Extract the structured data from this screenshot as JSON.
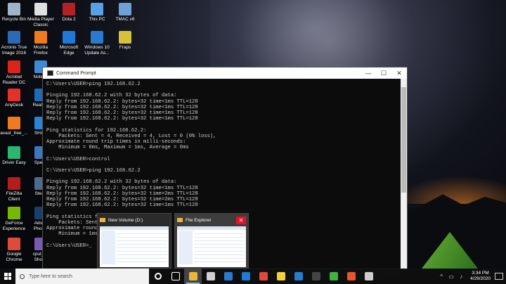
{
  "desktop_icons": [
    {
      "label": "Recycle Bin",
      "color": "#9fb4c9"
    },
    {
      "label": "Media Player\nClassic",
      "color": "#e0e0e0"
    },
    {
      "label": "Dota 2",
      "color": "#b22222"
    },
    {
      "label": "This PC",
      "color": "#5aa0e6"
    },
    {
      "label": "TMAC v6",
      "color": "#6fa0d8"
    },
    {
      "label": "Acronis True\nImage 2016",
      "color": "#2b6bb5"
    },
    {
      "label": "Mozilla\nFirefox",
      "color": "#f07b1e"
    },
    {
      "label": "Microsoft\nEdge",
      "color": "#1e7ad6"
    },
    {
      "label": "Windows 10\nUpdate As...",
      "color": "#2a7ad0"
    },
    {
      "label": "Fraps",
      "color": "#d6c23a"
    },
    {
      "label": "Acrobat\nReader DC",
      "color": "#d9251c"
    },
    {
      "label": "Notepa",
      "color": "#3f8ad6"
    },
    {
      "label": "AnyDesk",
      "color": "#e5312a"
    },
    {
      "label": "RealPla",
      "color": "#1f6ab8"
    },
    {
      "label": "avast_free_...",
      "color": "#f07b1e"
    },
    {
      "label": "SHAR",
      "color": "#2a84d6"
    },
    {
      "label": "Driver Easy",
      "color": "#2bb673"
    },
    {
      "label": "Speco",
      "color": "#3c78c0"
    },
    {
      "label": "FileZilla\nClient",
      "color": "#b51c1c"
    },
    {
      "label": "Stean",
      "color": "#4b6c8f"
    },
    {
      "label": "GeForce\nExperience",
      "color": "#77b900"
    },
    {
      "label": "Adobe\nPhotos",
      "color": "#1a3f6c"
    },
    {
      "label": "Google\nChrome",
      "color": "#e04a3a"
    },
    {
      "label": "cput_x6\nShortc",
      "color": "#7a5ab5"
    }
  ],
  "cmd": {
    "title": "Command Prompt",
    "minimize": "—",
    "maximize": "☐",
    "close": "✕",
    "lines": [
      "C:\\Users\\USER>ping 192.168.62.2",
      "",
      "Pinging 192.168.62.2 with 32 bytes of data:",
      "Reply from 192.168.62.2: bytes=32 time<1ms TTL=128",
      "Reply from 192.168.62.2: bytes=32 time<1ms TTL=128",
      "Reply from 192.168.62.2: bytes=32 time=1ms TTL=128",
      "Reply from 192.168.62.2: bytes=32 time<1ms TTL=128",
      "",
      "Ping statistics for 192.168.62.2:",
      "    Packets: Sent = 4, Received = 4, Lost = 0 (0% loss),",
      "Approximate round trip times in milli-seconds:",
      "    Minimum = 0ms, Maximum = 1ms, Average = 0ms",
      "",
      "C:\\Users\\USER>control",
      "",
      "C:\\Users\\USER>ping 192.168.62.2",
      "",
      "Pinging 192.168.62.2 with 32 bytes of data:",
      "Reply from 192.168.62.2: bytes=32 time<1ms TTL=128",
      "Reply from 192.168.62.2: bytes=32 time=2ms TTL=128",
      "Reply from 192.168.62.2: bytes=32 time=2ms TTL=128",
      "Reply from 192.168.62.2: bytes=32 time<1ms TTL=128",
      "",
      "Ping statistics fo",
      "    Packets: Sent",
      "Approximate round",
      "    Minimum = 1ms",
      "",
      "C:\\Users\\USER>_"
    ]
  },
  "thumbnails": [
    {
      "title": "New Volume (D:)"
    },
    {
      "title": "File Explorer",
      "close": "✕"
    }
  ],
  "taskbar": {
    "search_placeholder": "Type here to search",
    "apps": [
      {
        "name": "cortana-icon",
        "color": "#ffffff"
      },
      {
        "name": "task-view-icon",
        "color": "#ffffff"
      },
      {
        "name": "file-explorer-icon",
        "color": "#e9b63b"
      },
      {
        "name": "windows-security-icon",
        "color": "#d0d0d0"
      },
      {
        "name": "store-icon",
        "color": "#2a7ad0"
      },
      {
        "name": "edge-icon",
        "color": "#1e7ad6"
      },
      {
        "name": "chrome-icon",
        "color": "#e04a3a"
      },
      {
        "name": "sticky-notes-icon",
        "color": "#f2d13b"
      },
      {
        "name": "mail-icon",
        "color": "#2a7ad0"
      },
      {
        "name": "cmd-icon",
        "color": "#444444"
      },
      {
        "name": "camtasia-green-icon",
        "color": "#3fb23f"
      },
      {
        "name": "camtasia-orange-icon",
        "color": "#e8552a"
      },
      {
        "name": "settings-icon",
        "color": "#cccccc"
      }
    ],
    "time": "3:34 PM",
    "date": "4/29/2020"
  }
}
